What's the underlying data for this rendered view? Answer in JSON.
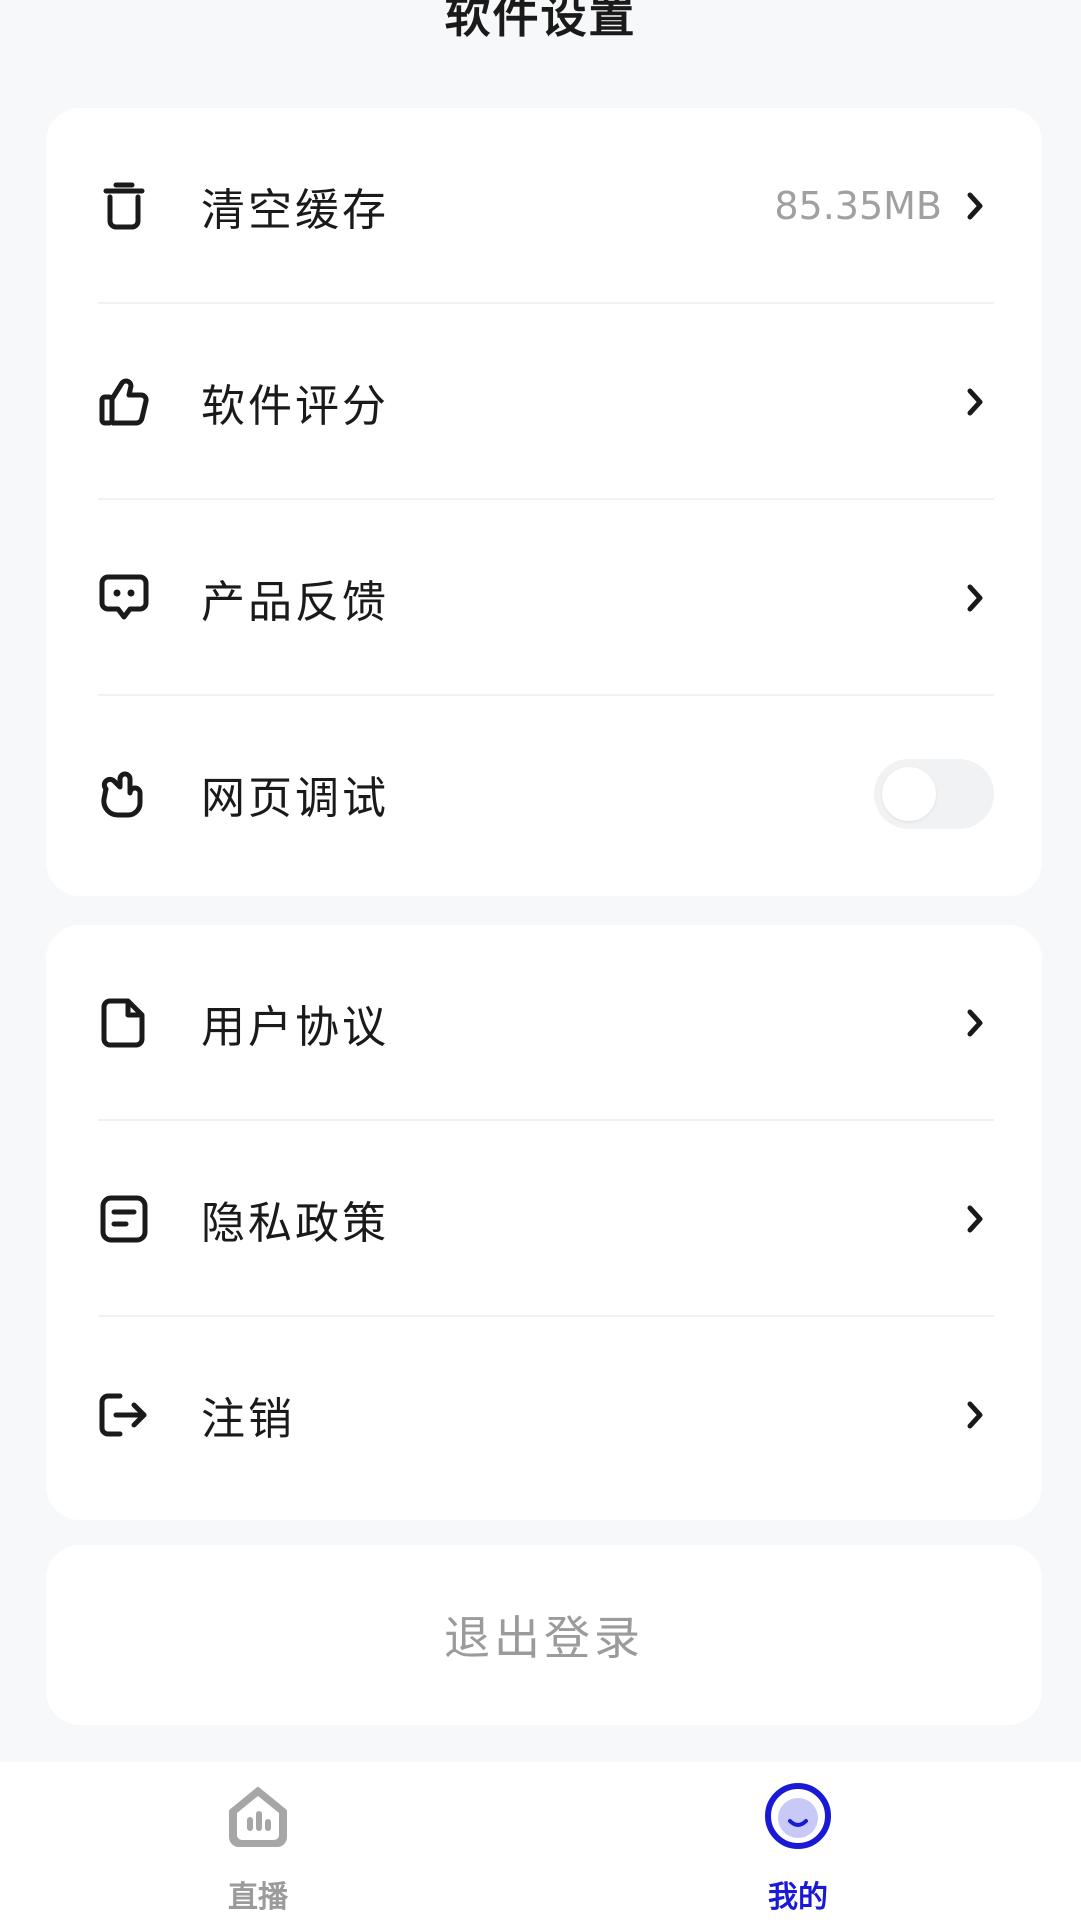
{
  "header": {
    "title": "软件设置"
  },
  "settings_group_1": [
    {
      "icon": "trash-icon",
      "label": "清空缓存",
      "value": "85.35MB",
      "control": "chevron"
    },
    {
      "icon": "thumbs-up-icon",
      "label": "软件评分",
      "value": "",
      "control": "chevron"
    },
    {
      "icon": "feedback-chat-icon",
      "label": "产品反馈",
      "value": "",
      "control": "chevron"
    },
    {
      "icon": "hand-point-icon",
      "label": "网页调试",
      "value": "",
      "control": "toggle",
      "toggle_on": false
    }
  ],
  "settings_group_2": [
    {
      "icon": "document-icon",
      "label": "用户协议",
      "value": "",
      "control": "chevron"
    },
    {
      "icon": "policy-note-icon",
      "label": "隐私政策",
      "value": "",
      "control": "chevron"
    },
    {
      "icon": "logout-arrow-icon",
      "label": "注销",
      "value": "",
      "control": "chevron"
    }
  ],
  "logout_button": {
    "label": "退出登录"
  },
  "tabbar": {
    "items": [
      {
        "icon": "live-home-icon",
        "label": "直播",
        "active": false
      },
      {
        "icon": "profile-face-icon",
        "label": "我的",
        "active": true
      }
    ]
  },
  "colors": {
    "page_background": "#f7f8fa",
    "card_background": "#ffffff",
    "secondary_text": "#a0a0a0",
    "active_tab": "#1a1ad6"
  }
}
